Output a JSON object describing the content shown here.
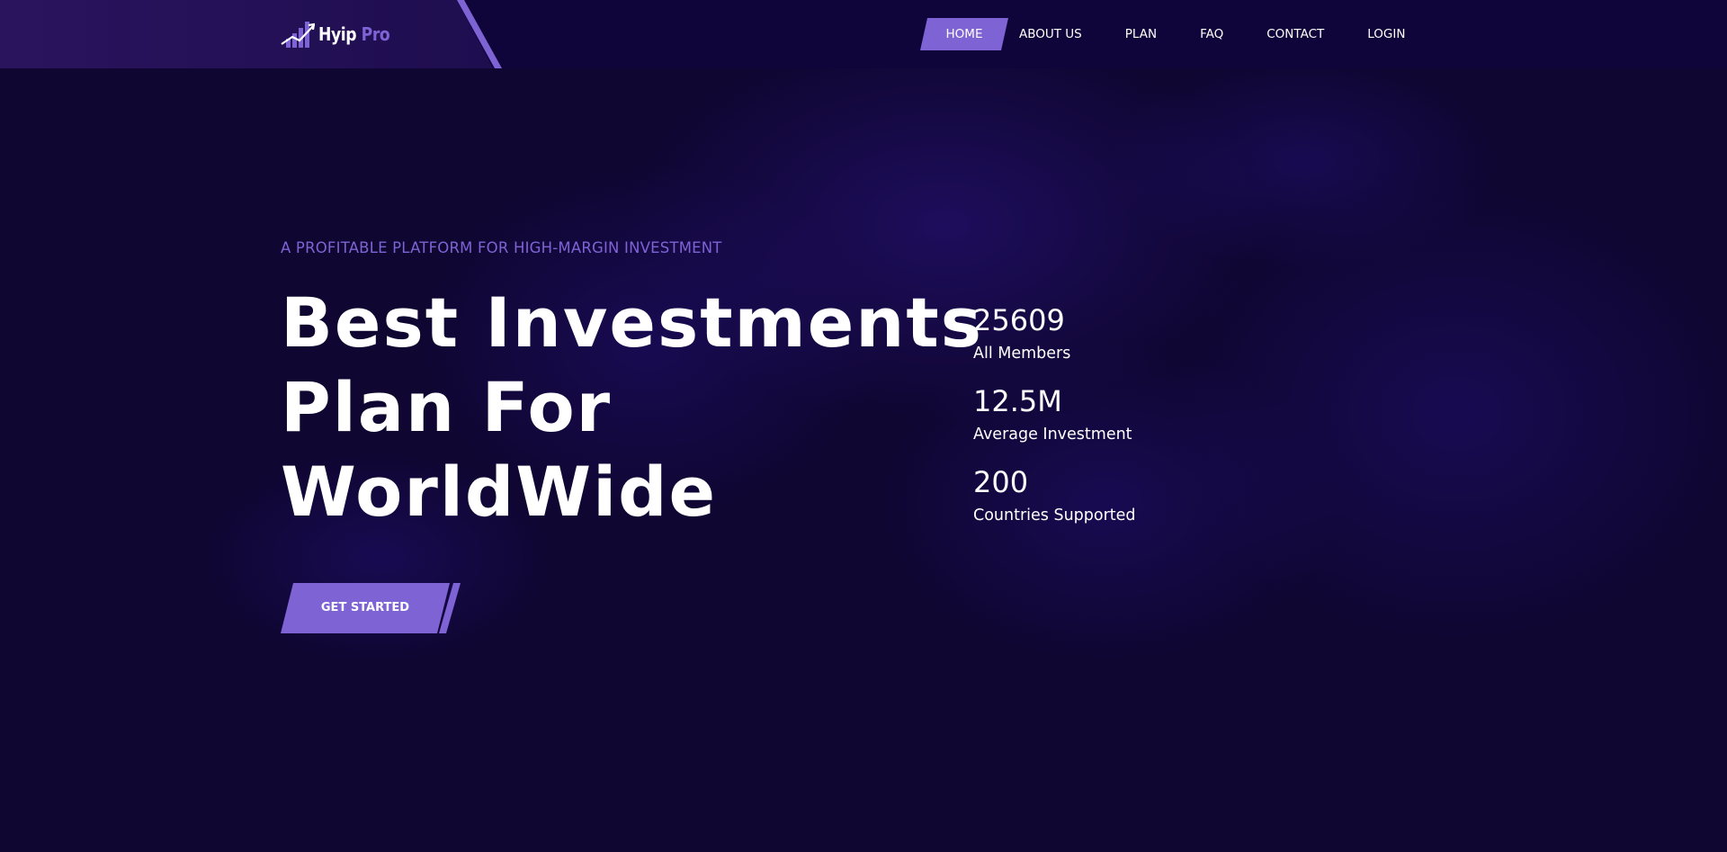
{
  "colors": {
    "background": "#0f0631",
    "header": "#10053a",
    "accent": "#7e63d5",
    "text": "#ffffff"
  },
  "brand": {
    "name_part1": "Hyip",
    "name_part2": "Pro",
    "icon": "bar-chart-logo-icon"
  },
  "nav": {
    "items": [
      {
        "label": "HOME",
        "active": true
      },
      {
        "label": "ABOUT US",
        "active": false
      },
      {
        "label": "PLAN",
        "active": false
      },
      {
        "label": "FAQ",
        "active": false
      },
      {
        "label": "CONTACT",
        "active": false
      },
      {
        "label": "LOGIN",
        "active": false
      }
    ]
  },
  "hero": {
    "tagline": "A PROFITABLE PLATFORM FOR HIGH-MARGIN INVESTMENT",
    "headline_lines": [
      "Best Investments",
      "Plan For",
      "WorldWide"
    ],
    "cta_label": "GET STARTED"
  },
  "stats": [
    {
      "value": "25609",
      "label": "All Members"
    },
    {
      "value": "12.5M",
      "label": "Average Investment"
    },
    {
      "value": "200",
      "label": "Countries Supported"
    }
  ]
}
